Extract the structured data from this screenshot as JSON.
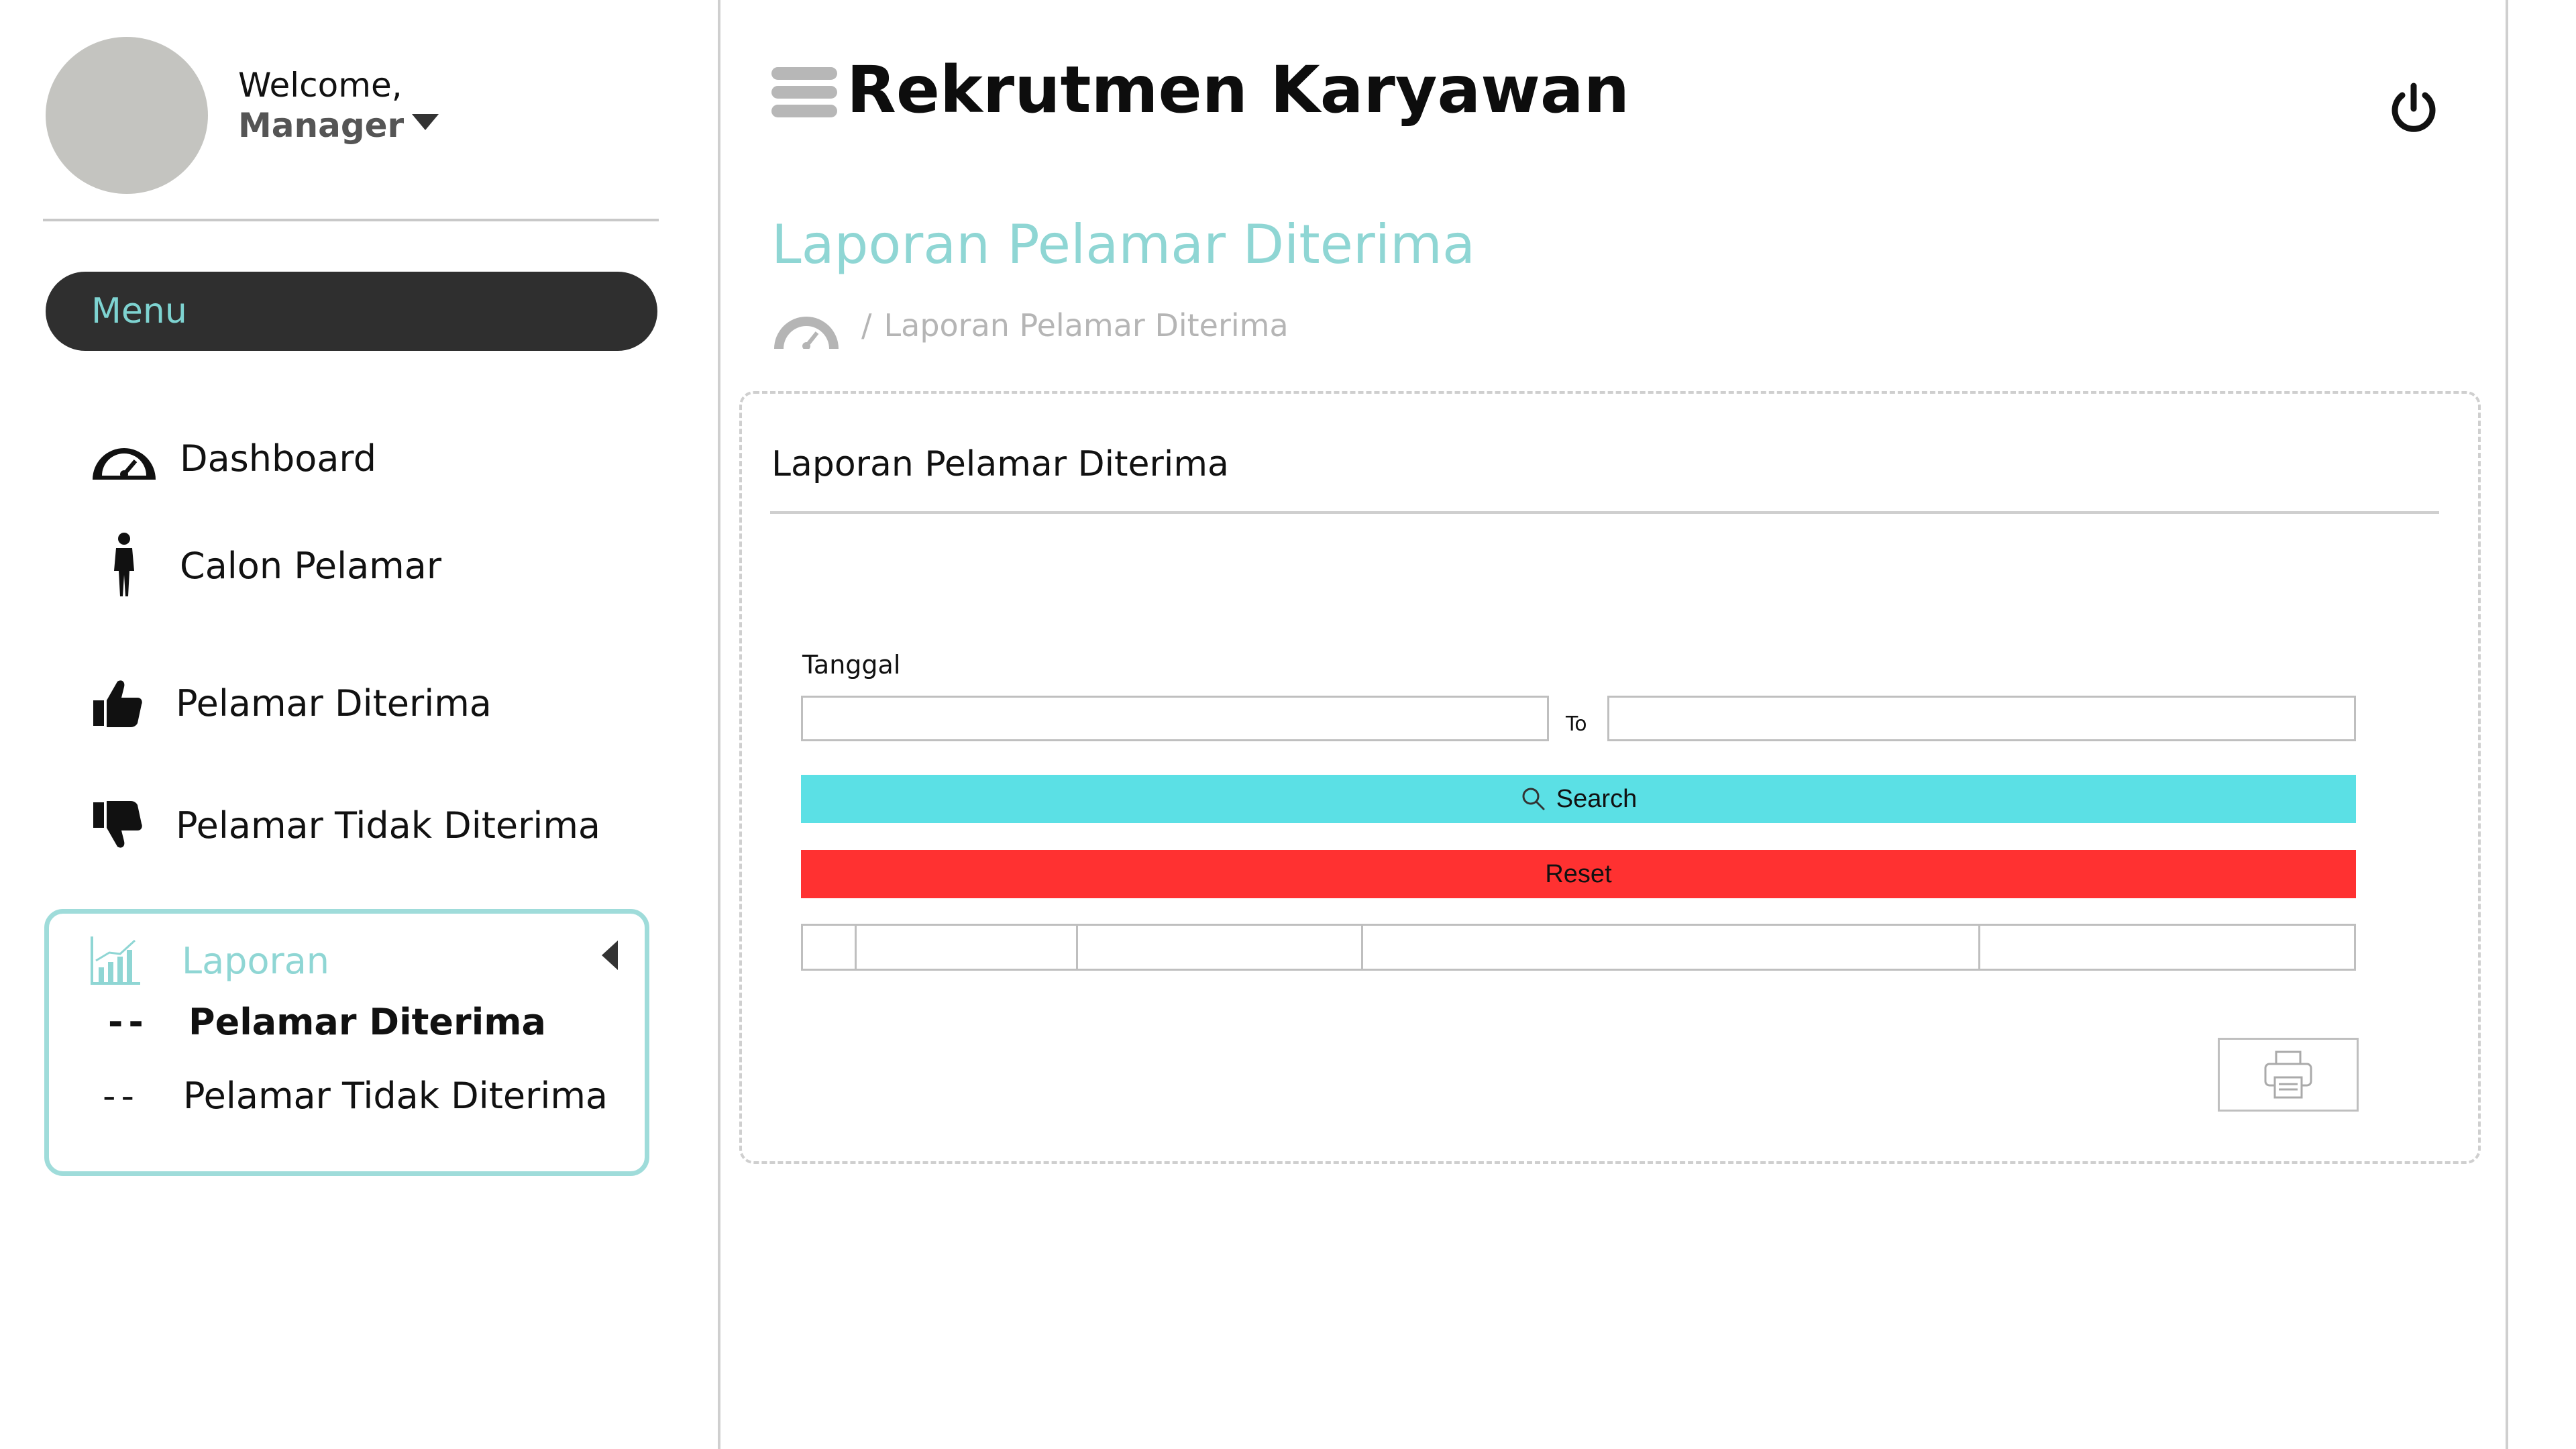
{
  "user": {
    "welcome": "Welcome,",
    "role": "Manager"
  },
  "sidebar": {
    "menu_label": "Menu",
    "items": [
      {
        "label": "Dashboard",
        "icon": "dashboard-gauge-icon"
      },
      {
        "label": "Calon Pelamar",
        "icon": "person-icon"
      },
      {
        "label": "Pelamar Diterima",
        "icon": "thumbs-up-icon"
      },
      {
        "label": "Pelamar Tidak Diterima",
        "icon": "thumbs-down-icon"
      }
    ],
    "laporan": {
      "label": "Laporan",
      "icon": "chart-icon",
      "sub_items": [
        {
          "label": "Pelamar Diterima",
          "active": true
        },
        {
          "label": "Pelamar Tidak Diterima",
          "active": false
        }
      ],
      "dash": "--"
    }
  },
  "header": {
    "title": "Rekrutmen Karyawan",
    "power_icon": "power-icon",
    "menu_icon": "hamburger-icon"
  },
  "page": {
    "title": "Laporan Pelamar Diterima",
    "breadcrumb": {
      "separator": "/",
      "current": "Laporan Pelamar Diterima"
    }
  },
  "card": {
    "title": "Laporan Pelamar Diterima",
    "date_label": "Tanggal",
    "to_label": "To",
    "date_from_value": "",
    "date_to_value": "",
    "search_label": "Search",
    "reset_label": "Reset"
  },
  "colors": {
    "accent": "#8fd6d4",
    "search": "#5be0e5",
    "reset": "#ff3131",
    "menu_bg": "#2f2f2f"
  }
}
